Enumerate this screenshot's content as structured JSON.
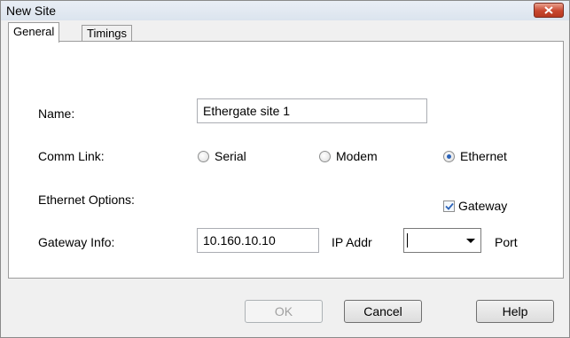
{
  "window": {
    "title": "New Site"
  },
  "tabs": [
    {
      "label": "General",
      "active": true
    },
    {
      "label": "Timings",
      "active": false
    }
  ],
  "form": {
    "name_label": "Name:",
    "name_value": "Ethergate site 1",
    "comm_link_label": "Comm Link:",
    "comm_options": [
      {
        "label": "Serial",
        "checked": false
      },
      {
        "label": "Modem",
        "checked": false
      },
      {
        "label": "Ethernet",
        "checked": true
      }
    ],
    "ethernet_options_label": "Ethernet Options:",
    "gateway_checkbox_label": "Gateway",
    "gateway_checked": true,
    "gateway_info_label": "Gateway Info:",
    "ip_value": "10.160.10.10",
    "ip_label": "IP Addr",
    "port_value": "",
    "port_label": "Port"
  },
  "buttons": {
    "ok": "OK",
    "cancel": "Cancel",
    "help": "Help"
  },
  "icons": {
    "close": "close-icon",
    "dropdown": "chevron-down-icon",
    "check": "check-icon"
  },
  "colors": {
    "close_button": "#c8462e",
    "radio_selected": "#2a62b8",
    "panel_bg": "#ffffff",
    "dialog_bg": "#f0f0f0"
  }
}
